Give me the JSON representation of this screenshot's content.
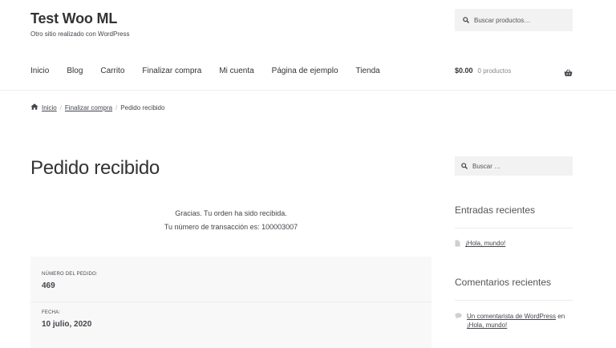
{
  "site": {
    "title": "Test Woo ML",
    "description": "Otro sitio realizado con WordPress"
  },
  "header_search": {
    "placeholder": "Buscar productos…"
  },
  "nav": {
    "items": [
      "Inicio",
      "Blog",
      "Carrito",
      "Finalizar compra",
      "Mi cuenta",
      "Página de ejemplo",
      "Tienda"
    ]
  },
  "cart": {
    "amount": "$0.00",
    "count": "0 productos",
    "icon": "basket-icon"
  },
  "breadcrumb": {
    "home": "Inicio",
    "parent": "Finalizar compra",
    "current": "Pedido recibido",
    "separator": "/"
  },
  "main": {
    "title": "Pedido recibido",
    "thanks_line1": "Gracias. Tu orden ha sido recibida.",
    "thanks_line2": "Tu número de transacción es: 100003007"
  },
  "order": {
    "number_label": "NÚMERO DEL PEDIDO:",
    "number_value": "469",
    "date_label": "FECHA:",
    "date_value": "10 julio, 2020"
  },
  "sidebar": {
    "search_placeholder": "Buscar …",
    "recent_posts_title": "Entradas recientes",
    "recent_post_1": "¡Hola, mundo!",
    "recent_comments_title": "Comentarios recientes",
    "comment_author": "Un comentarista de WordPress",
    "comment_on": "en",
    "comment_post": "¡Hola, mundo!"
  }
}
